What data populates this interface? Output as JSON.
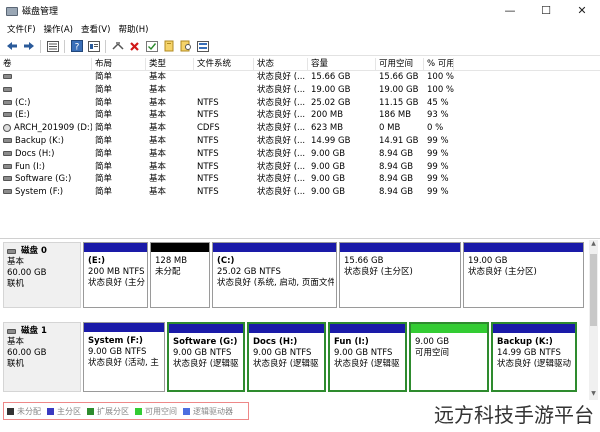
{
  "window": {
    "title": "磁盘管理",
    "minimize": "—",
    "maximize": "☐",
    "close": "✕"
  },
  "menu": [
    "文件(F)",
    "操作(A)",
    "查看(V)",
    "帮助(H)"
  ],
  "toolbar_icons": [
    "back-arrow-icon",
    "forward-arrow-icon",
    "list-view-icon",
    "help-icon",
    "properties-icon",
    "connect-icon",
    "delete-icon",
    "check-icon",
    "new-volume-icon",
    "search-volume-icon",
    "graph-view-icon"
  ],
  "table": {
    "headers": [
      "卷",
      "布局",
      "类型",
      "文件系统",
      "状态",
      "容量",
      "可用空间",
      "% 可用"
    ],
    "rows": [
      {
        "vol": "",
        "icon": "drive",
        "layout": "简单",
        "type": "基本",
        "fs": "",
        "status": "状态良好 (...",
        "cap": "15.66 GB",
        "free": "15.66 GB",
        "pct": "100 %"
      },
      {
        "vol": "",
        "icon": "drive",
        "layout": "简单",
        "type": "基本",
        "fs": "",
        "status": "状态良好 (...",
        "cap": "19.00 GB",
        "free": "19.00 GB",
        "pct": "100 %"
      },
      {
        "vol": "(C:)",
        "icon": "drive",
        "layout": "简单",
        "type": "基本",
        "fs": "NTFS",
        "status": "状态良好 (...",
        "cap": "25.02 GB",
        "free": "11.15 GB",
        "pct": "45 %"
      },
      {
        "vol": "(E:)",
        "icon": "drive",
        "layout": "简单",
        "type": "基本",
        "fs": "NTFS",
        "status": "状态良好 (...",
        "cap": "200 MB",
        "free": "186 MB",
        "pct": "93 %"
      },
      {
        "vol": "ARCH_201909 (D:)",
        "icon": "disc",
        "layout": "简单",
        "type": "基本",
        "fs": "CDFS",
        "status": "状态良好 (...",
        "cap": "623 MB",
        "free": "0 MB",
        "pct": "0 %"
      },
      {
        "vol": "Backup (K:)",
        "icon": "drive",
        "layout": "简单",
        "type": "基本",
        "fs": "NTFS",
        "status": "状态良好 (...",
        "cap": "14.99 GB",
        "free": "14.91 GB",
        "pct": "99 %"
      },
      {
        "vol": "Docs (H:)",
        "icon": "drive",
        "layout": "简单",
        "type": "基本",
        "fs": "NTFS",
        "status": "状态良好 (...",
        "cap": "9.00 GB",
        "free": "8.94 GB",
        "pct": "99 %"
      },
      {
        "vol": "Fun (I:)",
        "icon": "drive",
        "layout": "简单",
        "type": "基本",
        "fs": "NTFS",
        "status": "状态良好 (...",
        "cap": "9.00 GB",
        "free": "8.94 GB",
        "pct": "99 %"
      },
      {
        "vol": "Software (G:)",
        "icon": "drive",
        "layout": "简单",
        "type": "基本",
        "fs": "NTFS",
        "status": "状态良好 (...",
        "cap": "9.00 GB",
        "free": "8.94 GB",
        "pct": "99 %"
      },
      {
        "vol": "System (F:)",
        "icon": "drive",
        "layout": "简单",
        "type": "基本",
        "fs": "NTFS",
        "status": "状态良好 (...",
        "cap": "9.00 GB",
        "free": "8.94 GB",
        "pct": "99 %"
      }
    ]
  },
  "disks": [
    {
      "name": "磁盘 0",
      "kind": "基本",
      "size": "60.00 GB",
      "state": "联机",
      "partitions": [
        {
          "name": "(E:)",
          "line1": "200 MB NTFS",
          "line2": "状态良好 (主分",
          "bar": "#1a1aa8",
          "width": 65
        },
        {
          "name": "",
          "line1": "128 MB",
          "line2": "未分配",
          "bar": "#000000",
          "width": 60
        },
        {
          "name": "(C:)",
          "line1": "25.02 GB NTFS",
          "line2": "状态良好 (系统, 启动, 页面文件",
          "bar": "#1a1aa8",
          "width": 125
        },
        {
          "name": "",
          "line1": "15.66 GB",
          "line2": "状态良好 (主分区)",
          "bar": "#1a1aa8",
          "width": 122
        },
        {
          "name": "",
          "line1": "19.00 GB",
          "line2": "状态良好 (主分区)",
          "bar": "#1a1aa8",
          "width": 121
        }
      ]
    },
    {
      "name": "磁盘 1",
      "kind": "基本",
      "size": "60.00 GB",
      "state": "联机",
      "partitions": [
        {
          "name": "System  (F:)",
          "line1": "9.00 GB NTFS",
          "line2": "状态良好 (活动, 主",
          "bar": "#1a1aa8",
          "width": 82,
          "selected": false
        },
        {
          "name": "Software  (G:)",
          "line1": "9.00 GB NTFS",
          "line2": "状态良好 (逻辑驱",
          "bar": "#1a1aa8",
          "width": 78,
          "selected": true
        },
        {
          "name": "Docs  (H:)",
          "line1": "9.00 GB NTFS",
          "line2": "状态良好 (逻辑驱",
          "bar": "#1a1aa8",
          "width": 79,
          "selected": true
        },
        {
          "name": "Fun  (I:)",
          "line1": "9.00 GB NTFS",
          "line2": "状态良好 (逻辑驱",
          "bar": "#1a1aa8",
          "width": 79,
          "selected": true
        },
        {
          "name": "",
          "line1": "9.00 GB",
          "line2": "可用空间",
          "bar": "#33cc33",
          "width": 80,
          "selected": true
        },
        {
          "name": "Backup  (K:)",
          "line1": "14.99 GB NTFS",
          "line2": "状态良好 (逻辑驱动",
          "bar": "#1a1aa8",
          "width": 86,
          "selected": true
        }
      ]
    }
  ],
  "legend": [
    {
      "label": "未分配",
      "color": "#333333"
    },
    {
      "label": "主分区",
      "color": "#3a3ac0"
    },
    {
      "label": "扩展分区",
      "color": "#2e8b2e"
    },
    {
      "label": "可用空间",
      "color": "#33cc33"
    },
    {
      "label": "逻辑驱动器",
      "color": "#4d6fe0"
    }
  ],
  "watermark": "远方科技手游平台"
}
